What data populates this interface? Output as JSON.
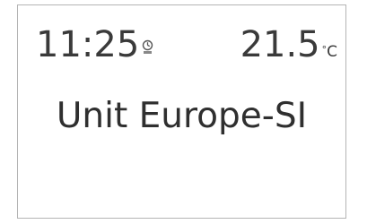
{
  "status": {
    "time": "11:25",
    "time_icon": "clock-icon",
    "temperature": "21.5",
    "temperature_unit": "C",
    "degree_symbol": "°"
  },
  "screen": {
    "title": "Unit Europe-SI"
  }
}
